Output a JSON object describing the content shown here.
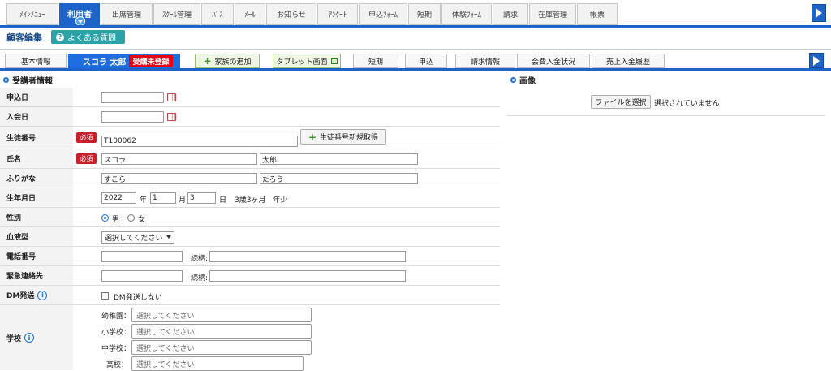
{
  "nav": {
    "tabs": [
      {
        "label": "ﾒｲﾝﾒﾆｭｰ"
      },
      {
        "label": "利用者",
        "active": true
      },
      {
        "label": "出席管理"
      },
      {
        "label": "ｽｸｰﾙ管理"
      },
      {
        "label": "ﾊﾟｽ"
      },
      {
        "label": "ﾒｰﾙ"
      },
      {
        "label": "お知らせ"
      },
      {
        "label": "ｱﾝｹｰﾄ"
      },
      {
        "label": "申込ﾌｫｰﾑ"
      },
      {
        "label": "短期"
      },
      {
        "label": "体験ﾌｫｰﾑ"
      },
      {
        "label": "請求"
      },
      {
        "label": "在庫管理"
      },
      {
        "label": "帳票"
      }
    ]
  },
  "header": {
    "title": "顧客編集",
    "faq_label": "よくある質問"
  },
  "subtabs": {
    "basic": "基本情報",
    "user_name": "スコラ 太郎",
    "user_badge": "受講未登録",
    "add_family": "家族の追加",
    "tablet": "タブレット画面",
    "short_term": "短期",
    "apply": "申込",
    "billing": "請求情報",
    "fee_status": "会費入金状況",
    "sales_history": "売上入金履歴"
  },
  "sections": {
    "student": "受講者情報",
    "image": "画像"
  },
  "image": {
    "choose_file": "ファイルを選択",
    "no_file": "選択されていません"
  },
  "form": {
    "apply_date": {
      "label": "申込日",
      "value": ""
    },
    "join_date": {
      "label": "入会日",
      "value": ""
    },
    "student_no": {
      "label": "生徒番号",
      "required": "必須",
      "value": "T100062",
      "button": "生徒番号新規取得"
    },
    "name": {
      "label": "氏名",
      "required": "必須",
      "last": "スコラ",
      "first": "太郎"
    },
    "kana": {
      "label": "ふりがな",
      "last": "すこら",
      "first": "たろう"
    },
    "birth": {
      "label": "生年月日",
      "year": "2022",
      "year_unit": "年",
      "month": "1",
      "month_unit": "月",
      "day": "3",
      "day_unit": "日",
      "age": "3歳3ヶ月　年少"
    },
    "gender": {
      "label": "性別",
      "male": "男",
      "female": "女"
    },
    "blood": {
      "label": "血液型",
      "value": "選択してください"
    },
    "phone": {
      "label": "電話番号",
      "relation_label": "続柄:"
    },
    "emergency": {
      "label": "緊急連絡先",
      "relation_label": "続柄:"
    },
    "dm": {
      "label": "DM発送",
      "checkbox": "DM発送しない"
    },
    "school": {
      "label": "学校",
      "rows": [
        {
          "label": "幼稚園：",
          "placeholder": "選択してください"
        },
        {
          "label": "小学校：",
          "placeholder": "選択してください"
        },
        {
          "label": "中学校：",
          "placeholder": "選択してください"
        },
        {
          "label": "高校：",
          "placeholder": "選択してください"
        }
      ]
    }
  },
  "colors": {
    "accent": "#1e64c8",
    "required": "#c8202a",
    "badge": "#e60012",
    "faq": "#2aa2a8"
  }
}
